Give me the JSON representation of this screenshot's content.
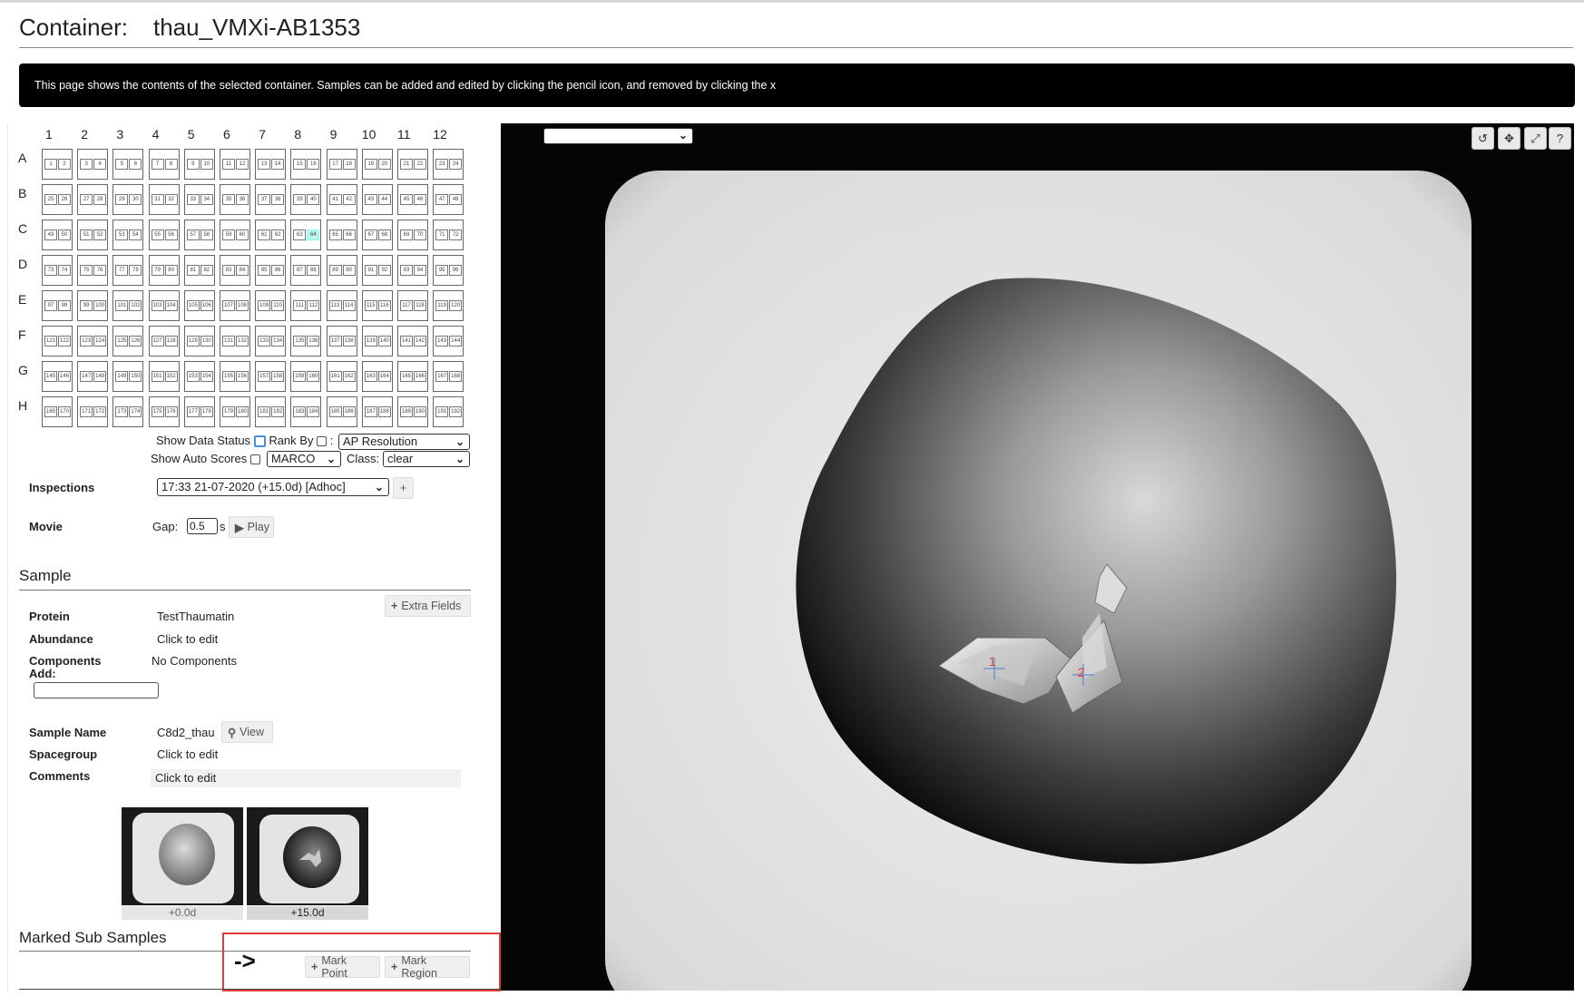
{
  "header": {
    "label": "Container:",
    "name": "thau_VMXi-AB1353"
  },
  "banner": {
    "text": "This page shows the contents of the selected container. Samples can be added and edited by clicking the pencil icon, and removed by clicking the x"
  },
  "plate": {
    "columns": [
      "1",
      "2",
      "3",
      "4",
      "5",
      "6",
      "7",
      "8",
      "9",
      "10",
      "11",
      "12"
    ],
    "rows": [
      "A",
      "B",
      "C",
      "D",
      "E",
      "F",
      "G",
      "H"
    ],
    "selected_drop": "64"
  },
  "plate_options": {
    "show_data_status": "Show Data Status",
    "rank_by": "Rank By",
    "rank_sep": ":",
    "rank_select": "AP Resolution",
    "show_auto_scores": "Show Auto Scores",
    "score_select": "MARCO",
    "class_label": "Class:",
    "class_select": "clear"
  },
  "inspections": {
    "label": "Inspections",
    "value": "17:33 21-07-2020 (+15.0d) [Adhoc]",
    "add": "+"
  },
  "movie": {
    "label": "Movie",
    "gap_label": "Gap:",
    "gap_value": "0.5",
    "unit": "s",
    "play": "Play"
  },
  "sample": {
    "title": "Sample",
    "extra_fields": "Extra Fields",
    "protein_label": "Protein",
    "protein_value": "TestThaumatin",
    "abundance_label": "Abundance",
    "abundance_value": "Click to edit",
    "components_label": "Components",
    "components_value": "No Components",
    "add_label": "Add:",
    "sample_name_label": "Sample Name",
    "sample_name_value": "C8d2_thau",
    "view": "View",
    "spacegroup_label": "Spacegroup",
    "spacegroup_value": "Click to edit",
    "comments_label": "Comments",
    "comments_value": "Click to edit"
  },
  "thumbnails": [
    {
      "caption": "+0.0d"
    },
    {
      "caption": "+15.0d"
    }
  ],
  "subsamples": {
    "title": "Marked Sub Samples",
    "arrow": "->",
    "mark_point": "Mark Point",
    "mark_region": "Mark Region"
  },
  "viewer": {
    "markers": [
      {
        "label": "1"
      },
      {
        "label": "2"
      }
    ],
    "tools": [
      "rotate-icon",
      "move-icon",
      "fullscreen-icon",
      "help-icon"
    ],
    "help": "?"
  },
  "colors": {
    "banner_bg": "#000000",
    "highlight": "#e03c3c",
    "selected_drop": "#bff4f6",
    "marker": "#e03c3c"
  }
}
